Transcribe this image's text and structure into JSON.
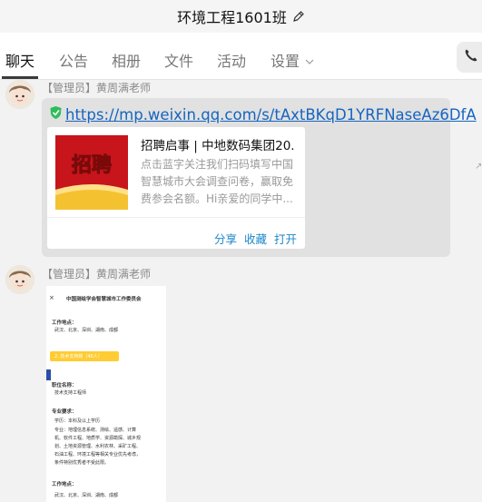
{
  "window": {
    "title": "环境工程1601班",
    "edit_icon": "pencil-icon"
  },
  "tabs": [
    {
      "label": "聊天",
      "active": true
    },
    {
      "label": "公告"
    },
    {
      "label": "相册"
    },
    {
      "label": "文件"
    },
    {
      "label": "活动"
    },
    {
      "label": "设置"
    }
  ],
  "phone_icon": "phone-icon",
  "messages": [
    {
      "sender": "【管理员】黄周满老师",
      "link": "https://mp.weixin.qq.com/s/tAxtBKqD1YRFNaseAz6DfA",
      "card": {
        "thumb_text": "招聘",
        "title": "招聘启事 | 中地数码集团20...",
        "desc": "点击蓝字关注我们扫码填写中国智慧城市大会调查问卷，赢取免费参会名额。Hi亲爱的同学中...",
        "actions": [
          "分享",
          "收藏",
          "打开"
        ]
      }
    },
    {
      "sender": "【管理员】黄周满老师",
      "image": {
        "header": "中国测绘学会智慧城市工作委员会",
        "lines": [
          "工作地点：",
          "武汉、北京、深圳、湖南、成都",
          "2. 技术支持岗（40人）",
          "职位名称：",
          "技术支持工程师",
          "专业要求：",
          "学历：本科及以上学历",
          "专业：地理信息系统、测绘、遥感、计算",
          "机、软件工程、地质学、资源勘探、城乡规",
          "划、土地资源管理、水利农林、采矿工程、",
          "石油工程、环境工程等相关专业优先考虑，",
          "条件特别优秀者不受此限。",
          "工作地点：",
          "武汉、北京、深圳、湖南、成都"
        ]
      }
    }
  ],
  "colors": {
    "link": "#1565c0",
    "action": "#1e88c9",
    "bubble": "#e1e1e1"
  }
}
